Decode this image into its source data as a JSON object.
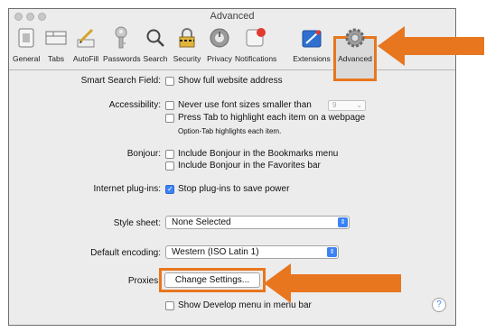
{
  "window": {
    "title": "Advanced"
  },
  "toolbar": {
    "items": [
      {
        "label": "General",
        "icon": "general-icon"
      },
      {
        "label": "Tabs",
        "icon": "tabs-icon"
      },
      {
        "label": "AutoFill",
        "icon": "autofill-icon"
      },
      {
        "label": "Passwords",
        "icon": "key-icon"
      },
      {
        "label": "Search",
        "icon": "search-icon"
      },
      {
        "label": "Security",
        "icon": "lock-icon"
      },
      {
        "label": "Privacy",
        "icon": "privacy-icon"
      },
      {
        "label": "Notifications",
        "icon": "notifications-icon"
      },
      {
        "label": "Extensions",
        "icon": "extensions-icon"
      },
      {
        "label": "Advanced",
        "icon": "gear-icon",
        "selected": true
      }
    ]
  },
  "settings": {
    "smart_search_label": "Smart Search Field:",
    "smart_search_option": "Show full website address",
    "accessibility_label": "Accessibility:",
    "font_size_option": "Never use font sizes smaller than",
    "font_size_value": "9",
    "tab_highlight_option": "Press Tab to highlight each item on a webpage",
    "tab_highlight_note": "Option-Tab highlights each item.",
    "bonjour_label": "Bonjour:",
    "bonjour_bookmarks": "Include Bonjour in the Bookmarks menu",
    "bonjour_favorites": "Include Bonjour in the Favorites bar",
    "plugins_label": "Internet plug-ins:",
    "plugins_option": "Stop plug-ins to save power",
    "stylesheet_label": "Style sheet:",
    "stylesheet_value": "None Selected",
    "encoding_label": "Default encoding:",
    "encoding_value": "Western (ISO Latin 1)",
    "proxies_label": "Proxies:",
    "proxies_button": "Change Settings...",
    "develop_option": "Show Develop menu in menu bar",
    "help": "?"
  },
  "colors": {
    "highlight": "#e8761e",
    "accent": "#3b82f6"
  }
}
